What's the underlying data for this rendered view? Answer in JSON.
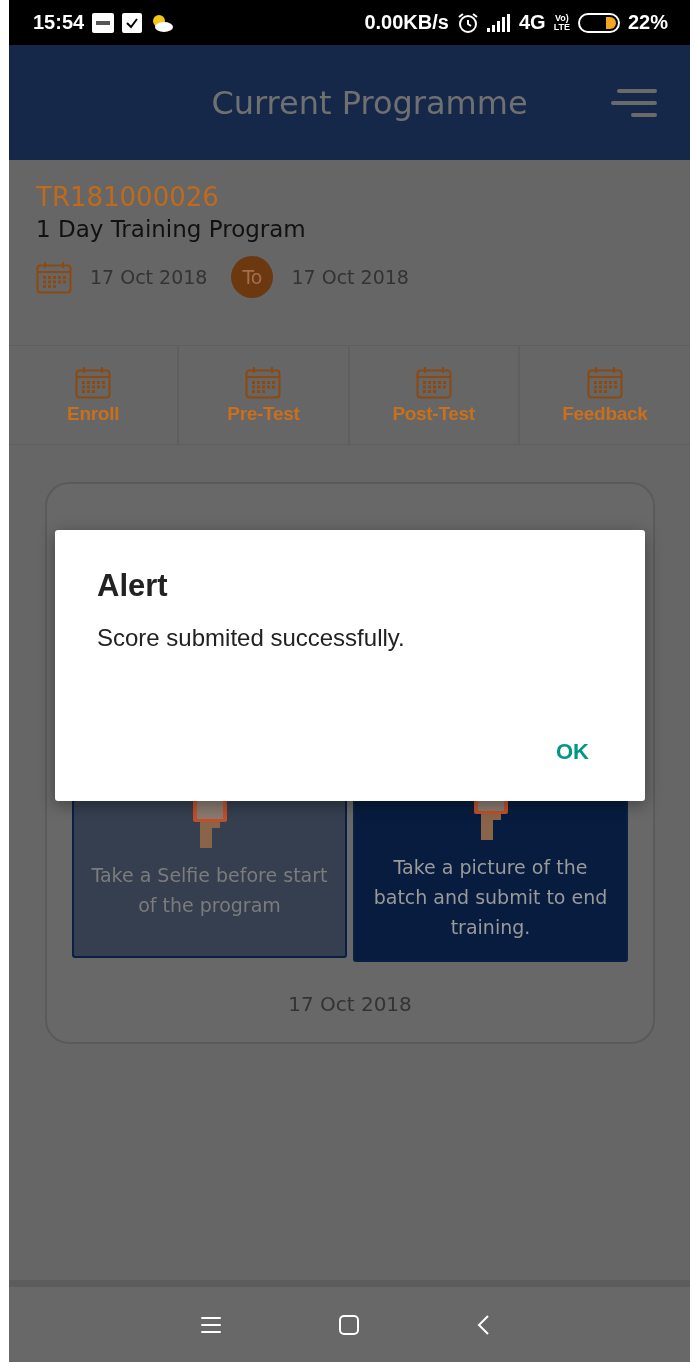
{
  "status_bar": {
    "time": "15:54",
    "speed": "0.00KB/s",
    "network": "4G",
    "volte_top": "Vo)",
    "volte_bottom": "LTE",
    "battery": "22%"
  },
  "header": {
    "title": "Current Programme"
  },
  "programme": {
    "code": "TR181000026",
    "name": "1 Day Training Program",
    "start_date": "17 Oct 2018",
    "separator": "To",
    "end_date": "17 Oct 2018"
  },
  "tabs": [
    {
      "label": "Enroll"
    },
    {
      "label": "Pre-Test"
    },
    {
      "label": "Post-Test"
    },
    {
      "label": "Feedback"
    }
  ],
  "day_card": {
    "actions": [
      {
        "text": "Take a Selfie before start of the program",
        "disabled": true
      },
      {
        "text": "Take a picture of the batch and submit to end training.",
        "disabled": false
      }
    ],
    "date": "17 Oct 2018"
  },
  "dialog": {
    "title": "Alert",
    "message": "Score submited successfully.",
    "buttons": [
      "OK"
    ]
  }
}
